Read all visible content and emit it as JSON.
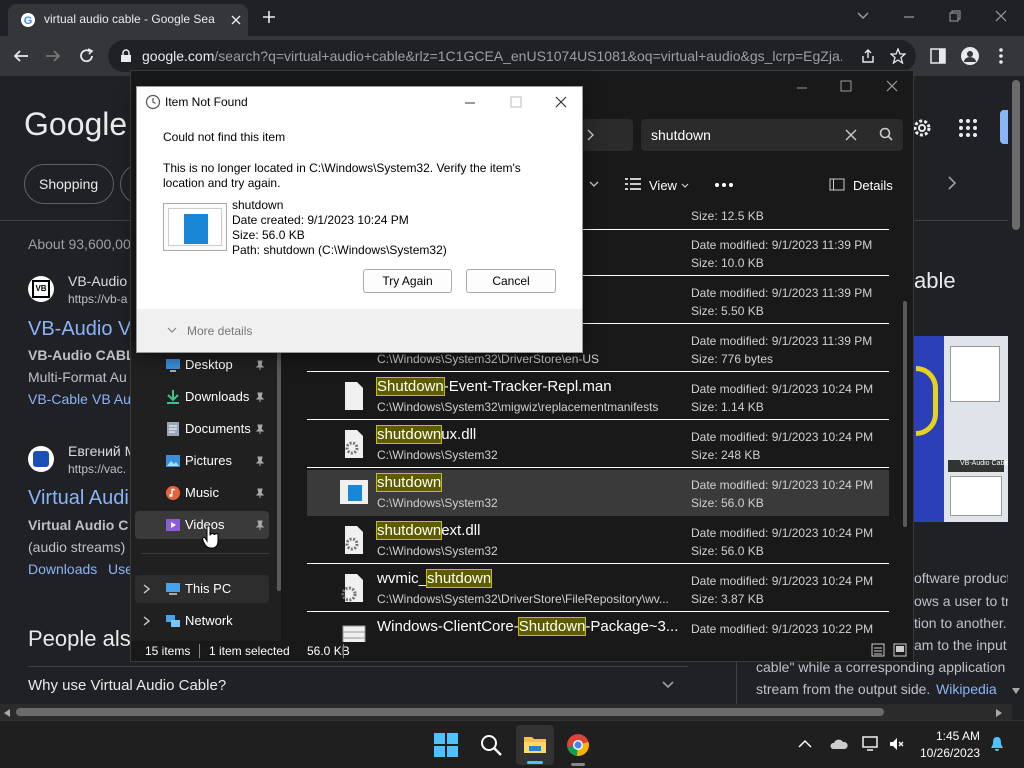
{
  "browser": {
    "tab_title": "virtual audio cable - Google Sea",
    "url_domain": "google.com",
    "url_rest": "/search?q=virtual+audio+cable&rlz=1C1GCEA_enUS1074US1081&oq=virtual+audio&gs_lcrp=EgZja..."
  },
  "google": {
    "logo": "Google",
    "chip_shopping": "Shopping",
    "about": "About 93,600,00",
    "r1_site": "VB-Audio",
    "r1_url": "https://vb-a",
    "r1_title": "VB-Audio Vi",
    "r1_line1": "VB-Audio CABL",
    "r1_line2": "Multi-Format Au",
    "r1_link1": "VB-Cable",
    "r1_link2": "VB Au",
    "r2_site": "Евгений М",
    "r2_url": "https://vac.",
    "r2_title": "Virtual Audi",
    "r2_line1": "Virtual Audio C",
    "r2_line2": "(audio streams)",
    "r2_link1": "Downloads",
    "r2_link2": "Use",
    "people_also": "People also",
    "paa_q1": "Why use Virtual Audio Cable?",
    "kp_title_frag": "able",
    "kp_line1": "oftware product",
    "kp_line2": "ows a user to tr",
    "kp_line3": "tion to another.",
    "kp_line4": "am to the input",
    "kp_line5": "cable\" while a corresponding application",
    "kp_line6": "stream from the output side.",
    "kp_wiki": "Wikipedia",
    "kp_img_label": "VB-Audio Cable"
  },
  "explorer": {
    "search_value": "shutdown",
    "view_label": "View",
    "details_label": "Details",
    "nav": [
      {
        "label": "Desktop",
        "icon": "desktop-icon"
      },
      {
        "label": "Downloads",
        "icon": "downloads-icon"
      },
      {
        "label": "Documents",
        "icon": "documents-icon"
      },
      {
        "label": "Pictures",
        "icon": "pictures-icon"
      },
      {
        "label": "Music",
        "icon": "music-icon"
      },
      {
        "label": "Videos",
        "icon": "videos-icon"
      },
      {
        "label": "This PC",
        "icon": "this-pc-icon"
      },
      {
        "label": "Network",
        "icon": "network-icon"
      }
    ],
    "rows": [
      {
        "pre": "",
        "hl": "",
        "post": "",
        "path": "",
        "dm_label": "",
        "dm": "",
        "size": "Size: 12.5 KB"
      },
      {
        "pre": "",
        "hl": "",
        "post": "",
        "path": "",
        "dm_label": "Date modified:",
        "dm": "9/1/2023 11:39 PM",
        "size": "Size: 10.0 KB"
      },
      {
        "pre": "",
        "hl": "",
        "post": "",
        "path": "",
        "dm_label": "Date modified:",
        "dm": "9/1/2023 11:39 PM",
        "size": "Size: 5.50 KB"
      },
      {
        "pre": "",
        "hl": "",
        "post": "",
        "path": "C:\\Windows\\System32\\DriverStore\\en-US",
        "dm_label": "Date modified:",
        "dm": "9/1/2023 11:39 PM",
        "size": "Size: 776 bytes"
      },
      {
        "pre": "",
        "hl": "Shutdown",
        "post": "-Event-Tracker-Repl.man",
        "path": "C:\\Windows\\System32\\migwiz\\replacementmanifests",
        "dm_label": "Date modified:",
        "dm": "9/1/2023 10:24 PM",
        "size": "Size: 1.14 KB"
      },
      {
        "pre": "",
        "hl": "shutdown",
        "post": "ux.dll",
        "path": "C:\\Windows\\System32",
        "dm_label": "Date modified:",
        "dm": "9/1/2023 10:24 PM",
        "size": "Size: 248 KB"
      },
      {
        "pre": "",
        "hl": "shutdown",
        "post": "",
        "path": "C:\\Windows\\System32",
        "dm_label": "Date modified:",
        "dm": "9/1/2023 10:24 PM",
        "size": "Size: 56.0 KB"
      },
      {
        "pre": "",
        "hl": "shutdown",
        "post": "ext.dll",
        "path": "C:\\Windows\\System32",
        "dm_label": "Date modified:",
        "dm": "9/1/2023 10:24 PM",
        "size": "Size: 56.0 KB"
      },
      {
        "pre": "wvmic_",
        "hl": "shutdown",
        "post": "",
        "path": "C:\\Windows\\System32\\DriverStore\\FileRepository\\wv...",
        "dm_label": "Date modified:",
        "dm": "9/1/2023 10:24 PM",
        "size": "Size: 3.87 KB"
      },
      {
        "pre": "Windows-ClientCore-",
        "hl": "Shutdown",
        "post": "-Package~3...",
        "path": "",
        "dm_label": "Date modified:",
        "dm": "9/1/2023 10:22 PM",
        "size": ""
      }
    ],
    "status_items": "15 items",
    "status_selected": "1 item selected",
    "status_size": "56.0 KB"
  },
  "dialog": {
    "title": "Item Not Found",
    "heading": "Could not find this item",
    "msg1": "This is no longer located in C:\\Windows\\System32. Verify the item's",
    "msg2": "location and try again.",
    "file_name": "shutdown",
    "date_created": "Date created: 9/1/2023 10:24 PM",
    "size": "Size: 56.0 KB",
    "path": "Path: shutdown (C:\\Windows\\System32)",
    "try_again": "Try Again",
    "cancel": "Cancel",
    "more_details": "More details"
  },
  "taskbar": {
    "time": "1:45 AM",
    "date": "10/26/2023"
  },
  "colors": {
    "chrome_dark": "#202124",
    "toolbar": "#35363a",
    "link_blue": "#8ab4f8",
    "highlight": "#5c5c00",
    "win_blue": "#0078d4"
  }
}
